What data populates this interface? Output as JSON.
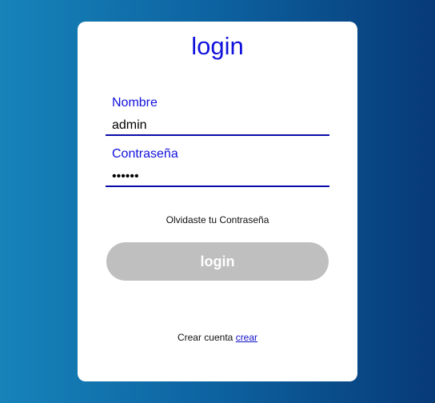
{
  "login_card": {
    "title": "login",
    "username": {
      "label": "Nombre",
      "value": "admin"
    },
    "password": {
      "label": "Contraseña",
      "value": "••••••"
    },
    "forgot_password": "Olvidaste tu Contraseña",
    "submit_label": "login",
    "signup": {
      "prompt": "Crear cuenta",
      "link": "crear"
    }
  },
  "colors": {
    "accent": "#1111dd",
    "input_underline": "#0a0aaa",
    "button_disabled": "#bfbfbf",
    "gradient_start": "#1683b9",
    "gradient_end": "#073a78"
  }
}
